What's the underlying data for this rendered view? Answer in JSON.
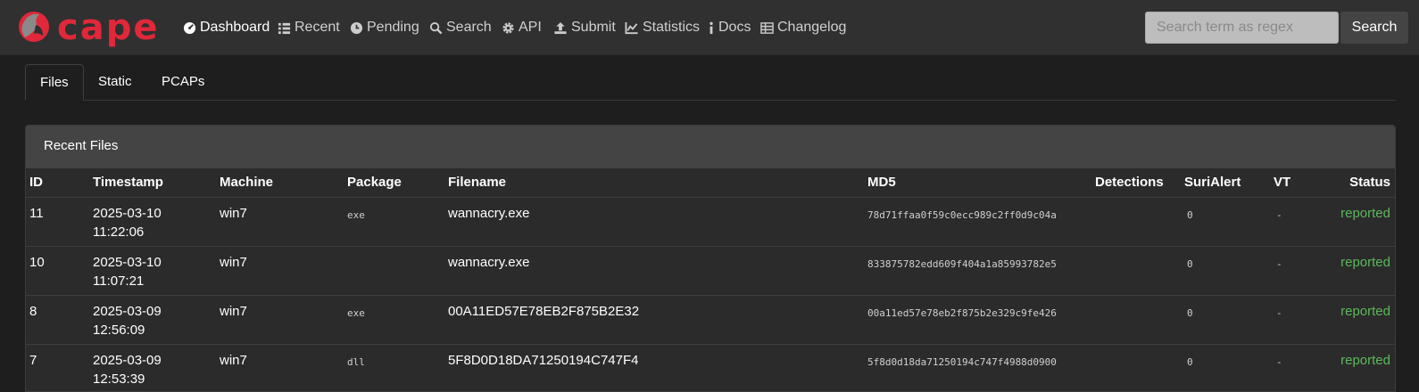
{
  "brand": {
    "name": "cape",
    "color": "#e0283a"
  },
  "nav": [
    {
      "label": "Dashboard",
      "icon": "dashboard-icon"
    },
    {
      "label": "Recent",
      "icon": "list-icon"
    },
    {
      "label": "Pending",
      "icon": "clock-icon"
    },
    {
      "label": "Search",
      "icon": "search-icon"
    },
    {
      "label": "API",
      "icon": "gear-icon"
    },
    {
      "label": "Submit",
      "icon": "upload-icon"
    },
    {
      "label": "Statistics",
      "icon": "chart-icon"
    },
    {
      "label": "Docs",
      "icon": "info-icon"
    },
    {
      "label": "Changelog",
      "icon": "table-icon"
    }
  ],
  "search": {
    "placeholder": "Search term as regex",
    "button": "Search"
  },
  "tabs": [
    "Files",
    "Static",
    "PCAPs"
  ],
  "panel": {
    "title": "Recent Files",
    "columns": [
      "ID",
      "Timestamp",
      "Machine",
      "Package",
      "Filename",
      "MD5",
      "Detections",
      "SuriAlert",
      "VT",
      "Status"
    ],
    "rows": [
      {
        "id": "11",
        "date": "2025-03-10",
        "time": "11:22:06",
        "machine": "win7",
        "package": "exe",
        "filename": "wannacry.exe",
        "md5": "78d71ffaa0f59c0ecc989c2ff0d9c04a",
        "detections": "",
        "suri": "0",
        "vt": "-",
        "status": "reported"
      },
      {
        "id": "10",
        "date": "2025-03-10",
        "time": "11:07:21",
        "machine": "win7",
        "package": "",
        "filename": "wannacry.exe",
        "md5": "833875782edd609f404a1a85993782e5",
        "detections": "",
        "suri": "0",
        "vt": "-",
        "status": "reported"
      },
      {
        "id": "8",
        "date": "2025-03-09",
        "time": "12:56:09",
        "machine": "win7",
        "package": "exe",
        "filename": "00A11ED57E78EB2F875B2E32",
        "md5": "00a11ed57e78eb2f875b2e329c9fe426",
        "detections": "",
        "suri": "0",
        "vt": "-",
        "status": "reported"
      },
      {
        "id": "7",
        "date": "2025-03-09",
        "time": "12:53:39",
        "machine": "win7",
        "package": "dll",
        "filename": "5F8D0D18DA71250194C747F4",
        "md5": "5f8d0d18da71250194c747f4988d0900",
        "detections": "",
        "suri": "0",
        "vt": "-",
        "status": "reported"
      }
    ]
  },
  "colors": {
    "navbar": "#303030",
    "background": "#1e1e1e",
    "status_reported": "#5cb85c"
  }
}
